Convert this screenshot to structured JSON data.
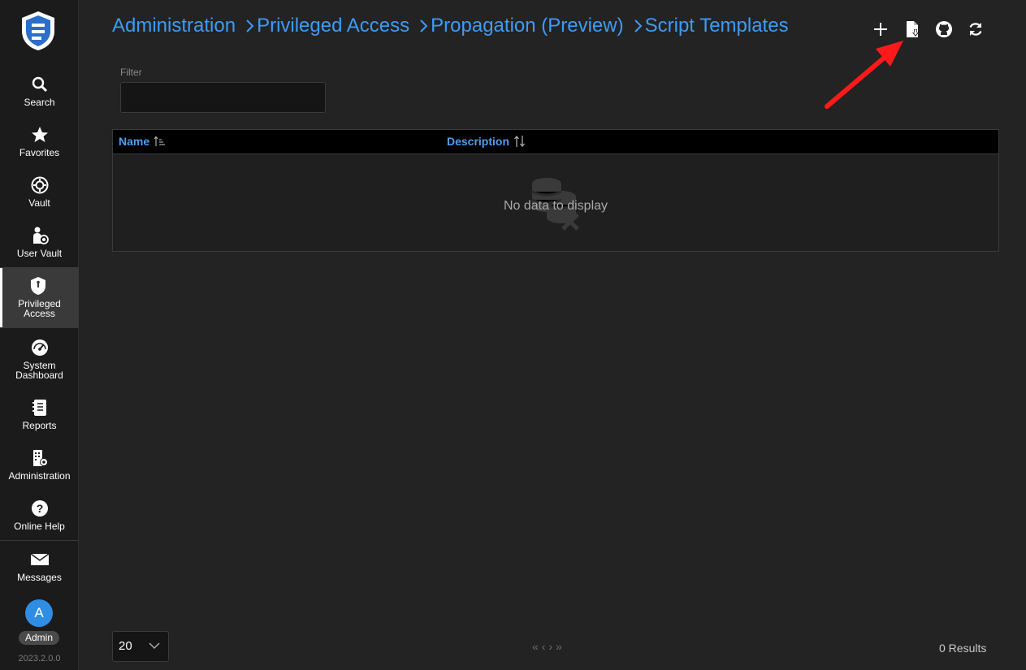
{
  "sidebar": {
    "items": [
      {
        "label": "Search",
        "icon": "search-icon"
      },
      {
        "label": "Favorites",
        "icon": "star-icon"
      },
      {
        "label": "Vault",
        "icon": "vault-icon"
      },
      {
        "label": "User Vault",
        "icon": "user-vault-icon"
      },
      {
        "label": "Privileged\nAccess",
        "icon": "shield-icon",
        "active": true
      },
      {
        "label": "System\nDashboard",
        "icon": "dashboard-icon"
      },
      {
        "label": "Reports",
        "icon": "reports-icon"
      },
      {
        "label": "Administration",
        "icon": "building-icon"
      },
      {
        "label": "Online Help",
        "icon": "help-icon"
      },
      {
        "label": "Messages",
        "icon": "envelope-icon"
      }
    ],
    "user_initial": "A",
    "role": "Admin",
    "version": "2023.2.0.0"
  },
  "breadcrumb": [
    "Administration",
    "Privileged Access",
    "Propagation (Preview)",
    "Script Templates"
  ],
  "toolbar": [
    "plus-icon",
    "import-file-icon",
    "github-icon",
    "refresh-icon"
  ],
  "filter": {
    "label": "Filter",
    "value": ""
  },
  "grid": {
    "columns": [
      "Name",
      "Description"
    ],
    "empty_text": "No data to display"
  },
  "footer": {
    "page_size": "20",
    "pager": [
      "«",
      "‹",
      "›",
      "»"
    ],
    "results": "0 Results"
  },
  "colors": {
    "accent": "#3d9bf5",
    "avatar": "#2f8de4",
    "annotation_arrow": "#ff1a1a"
  }
}
